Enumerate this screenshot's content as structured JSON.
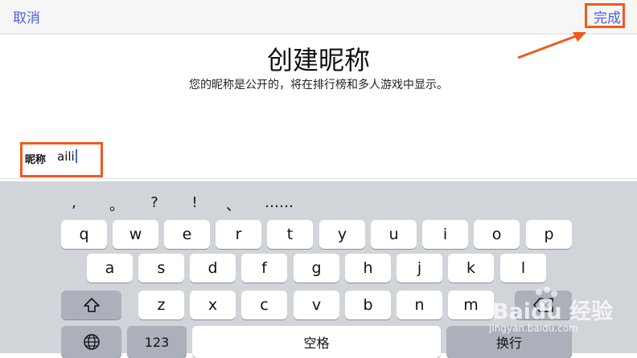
{
  "navbar": {
    "cancel_label": "取消",
    "done_label": "完成"
  },
  "title": "创建昵称",
  "subtitle": "您的昵称是公开的，将在排行榜和多人游戏中显示。",
  "nickname_field": {
    "label": "昵称",
    "value": "aili"
  },
  "keyboard": {
    "punctuation": [
      ",",
      "。",
      "?",
      "!",
      "、",
      "……"
    ],
    "row1": [
      "q",
      "w",
      "e",
      "r",
      "t",
      "y",
      "u",
      "i",
      "o",
      "p"
    ],
    "row2": [
      "a",
      "s",
      "d",
      "f",
      "g",
      "h",
      "j",
      "k",
      "l"
    ],
    "row3": [
      "z",
      "x",
      "c",
      "v",
      "b",
      "n",
      "m"
    ],
    "numbers_label": "123",
    "space_label": "空格",
    "return_label": "换行",
    "shift_icon": "shift-arrow-icon",
    "globe_icon": "globe-icon",
    "delete_icon": "backspace-icon"
  },
  "watermark": {
    "brand": "Baidu 经验",
    "url": "jingyan.baidu.com"
  },
  "colors": {
    "accent": "#4a62d6",
    "highlight": "#f05a1c",
    "keyboard_bg": "#d1d4d9"
  }
}
